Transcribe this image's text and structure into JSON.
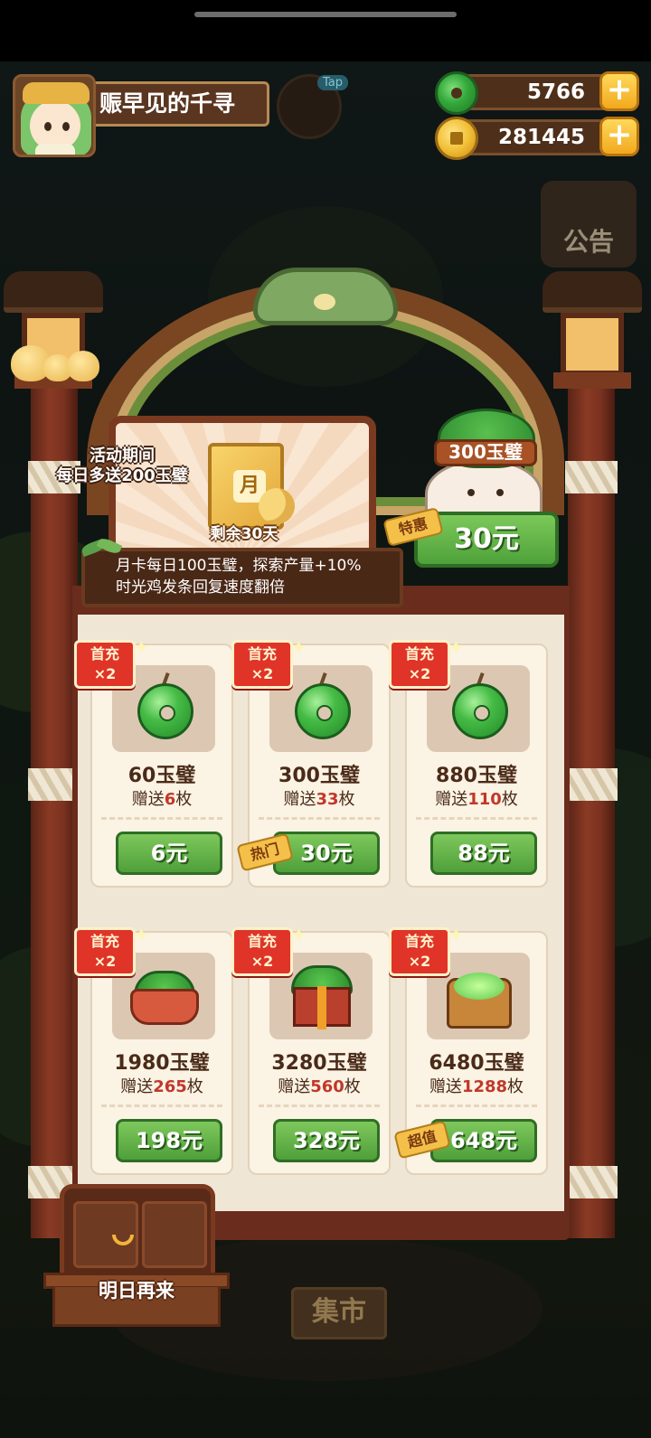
{
  "player": {
    "name": "赈早见的千寻"
  },
  "hud": {
    "tap_badge": "Tap",
    "jade_count": "5766",
    "coin_count": "281445",
    "plus": "+",
    "notice_label": "公告"
  },
  "monthly_card": {
    "event_line1": "活动期间",
    "event_line2": "每日多送200玉璧",
    "book_glyph": "月",
    "remaining": "剩余30天",
    "desc_line1": "月卡每日100玉璧，探索产量+10%",
    "desc_line2": "时光鸡发条回复速度翻倍"
  },
  "special_offer": {
    "amount": "300玉璧",
    "tag": "特惠",
    "price": "30元"
  },
  "shop": {
    "first_charge_line1": "首充",
    "first_charge_line2": "×2",
    "gift_prefix": "赠送",
    "gift_suffix": "枚",
    "items": [
      {
        "amount": "60玉璧",
        "bonus": "6",
        "price": "6元",
        "icon": "jade-disc-icon"
      },
      {
        "amount": "300玉璧",
        "bonus": "33",
        "price": "30元",
        "icon": "jade-disc-icon",
        "tag": "热门"
      },
      {
        "amount": "880玉璧",
        "bonus": "110",
        "price": "88元",
        "icon": "jade-disc-icon"
      },
      {
        "amount": "1980玉璧",
        "bonus": "265",
        "price": "198元",
        "icon": "jade-basket-icon"
      },
      {
        "amount": "3280玉璧",
        "bonus": "560",
        "price": "328元",
        "icon": "jade-giftbox-icon"
      },
      {
        "amount": "6480玉璧",
        "bonus": "1288",
        "price": "648元",
        "icon": "jade-chest-icon",
        "tag": "超值"
      }
    ]
  },
  "bottom": {
    "come_back": "明日再来",
    "market": "集市"
  }
}
